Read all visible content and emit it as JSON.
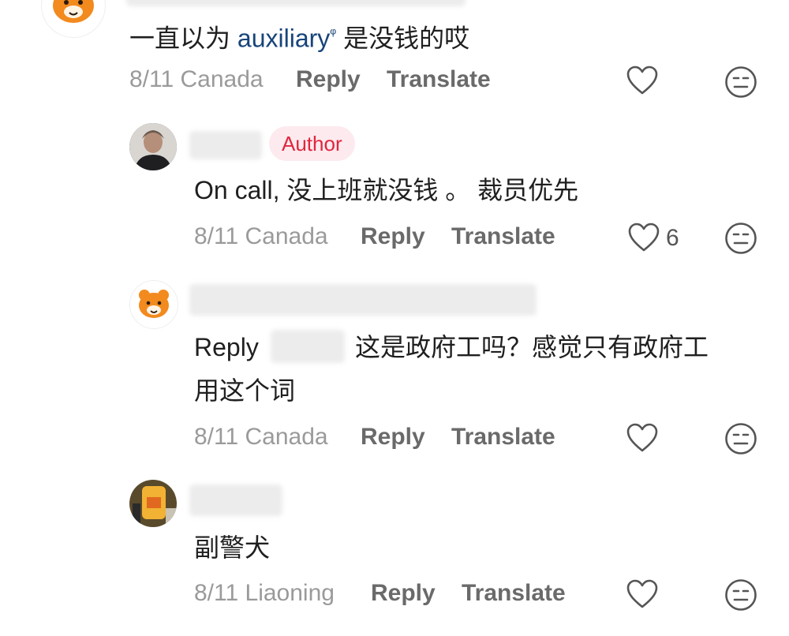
{
  "comments": [
    {
      "text_prefix": "一直以为 ",
      "link_text": "auxiliary",
      "link_mark": "ᵠ",
      "text_suffix": " 是没钱的哎",
      "date": "8/11",
      "location": "Canada",
      "reply_label": "Reply",
      "translate_label": "Translate"
    },
    {
      "badge": "Author",
      "text": "On call, 没上班就没钱 。 裁员优先",
      "date": "8/11",
      "location": "Canada",
      "reply_label": "Reply",
      "translate_label": "Translate",
      "like_count": "6"
    },
    {
      "reply_prefix": "Reply",
      "text_line1": "这是政府工吗？感觉只有政府工",
      "text_line2": "用这个词",
      "date": "8/11",
      "location": "Canada",
      "reply_label": "Reply",
      "translate_label": "Translate"
    },
    {
      "text": "副警犬",
      "date": "8/11",
      "location": "Liaoning",
      "reply_label": "Reply",
      "translate_label": "Translate"
    }
  ],
  "icons": {
    "like": "heart-icon",
    "react": "neutral-face-icon",
    "avatar_bear": "bear-avatar"
  },
  "colors": {
    "author_badge_bg": "#fdeaee",
    "author_badge_text": "#e0263f",
    "link": "#17447a",
    "meta": "#9a9a9a"
  }
}
